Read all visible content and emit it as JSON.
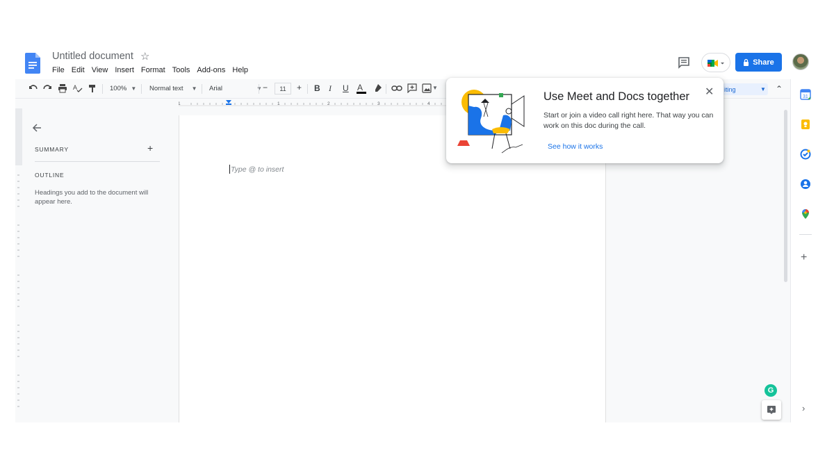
{
  "header": {
    "title": "Untitled document",
    "menu": [
      "File",
      "Edit",
      "View",
      "Insert",
      "Format",
      "Tools",
      "Add-ons",
      "Help"
    ],
    "share_label": "Share"
  },
  "toolbar": {
    "zoom": "100%",
    "style": "Normal text",
    "font": "Arial",
    "font_size": "11",
    "mode_partial": "iting"
  },
  "ruler": {
    "labels": [
      "1",
      "1",
      "2",
      "3",
      "4"
    ]
  },
  "left_panel": {
    "summary_label": "SUMMARY",
    "outline_label": "OUTLINE",
    "outline_hint": "Headings you add to the document will appear here."
  },
  "page": {
    "placeholder": "Type @ to insert"
  },
  "popup": {
    "title": "Use Meet and Docs together",
    "text": "Start or join a video call right here. That way you can work on this doc during the call.",
    "link": "See how it works"
  },
  "colors": {
    "accent": "#1a73e8",
    "docs_blue": "#4285f4",
    "grammarly": "#15c39a"
  },
  "icons": [
    "docs-logo-icon",
    "star-icon",
    "comment-icon",
    "meet-icon",
    "lock-icon",
    "undo-icon",
    "redo-icon",
    "print-icon",
    "spellcheck-icon",
    "paint-format-icon",
    "bold-icon",
    "italic-icon",
    "underline-icon",
    "text-color-icon",
    "highlight-icon",
    "link-icon",
    "add-comment-icon",
    "image-icon",
    "back-arrow-icon",
    "plus-icon",
    "close-icon",
    "calendar-icon",
    "keep-icon",
    "tasks-icon",
    "contacts-icon",
    "maps-icon",
    "grammarly-icon",
    "explore-icon",
    "chevron-right-icon"
  ]
}
